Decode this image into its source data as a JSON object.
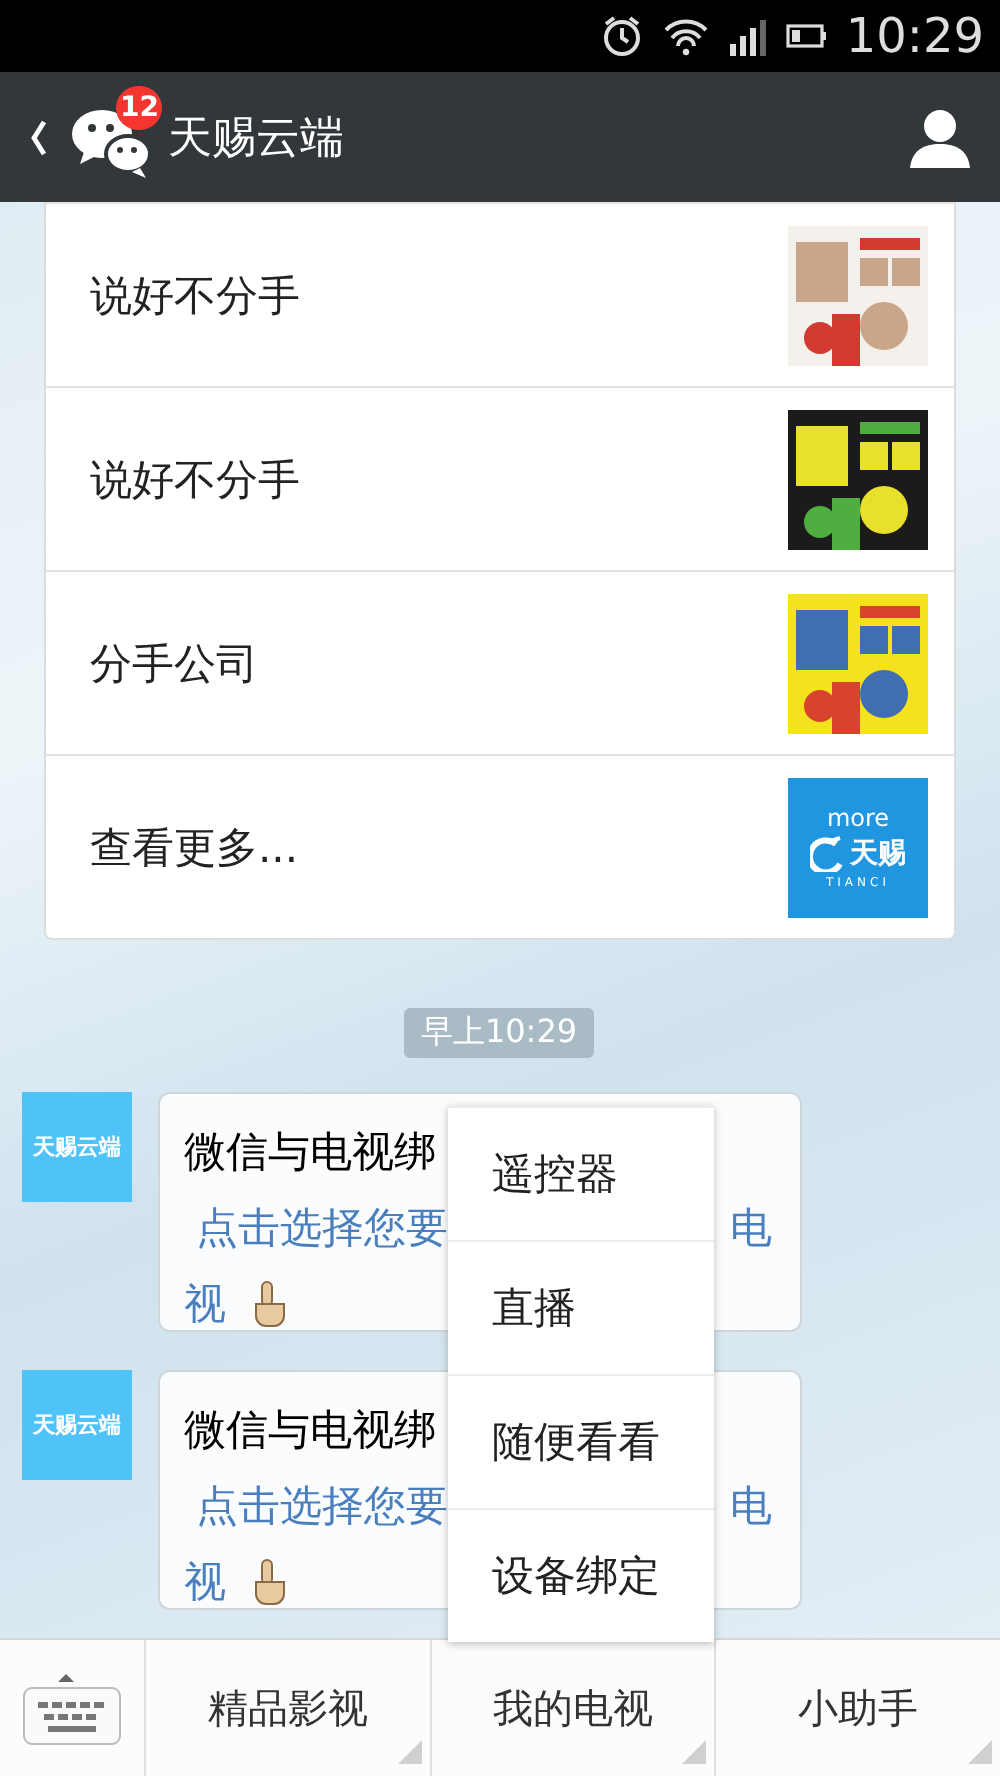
{
  "status_bar": {
    "time": "10:29"
  },
  "header": {
    "badge": "12",
    "title": "天赐云端"
  },
  "movies": [
    {
      "kind": "poster",
      "title": "说好不分手"
    },
    {
      "kind": "poster",
      "title": "说好不分手"
    },
    {
      "kind": "poster",
      "title": "分手公司"
    },
    {
      "kind": "more",
      "title": "查看更多...",
      "tile": {
        "label": "more",
        "brand": "天赐",
        "brand_latin": "TIANCI"
      }
    }
  ],
  "timestamp": "早上10:29",
  "messages": [
    {
      "avatar": "天赐云端",
      "text": "微信与电视绑",
      "link_start": "点击选择您要",
      "link_end": "电",
      "link_last": "视"
    },
    {
      "avatar": "天赐云端",
      "text": "微信与电视绑",
      "link_start": "点击选择您要",
      "link_end": "电",
      "link_last": "视"
    }
  ],
  "popup_menu": {
    "items": [
      "遥控器",
      "直播",
      "随便看看",
      "设备绑定"
    ]
  },
  "bottom_bar": {
    "menus": [
      "精品影视",
      "我的电视",
      "小助手"
    ]
  }
}
